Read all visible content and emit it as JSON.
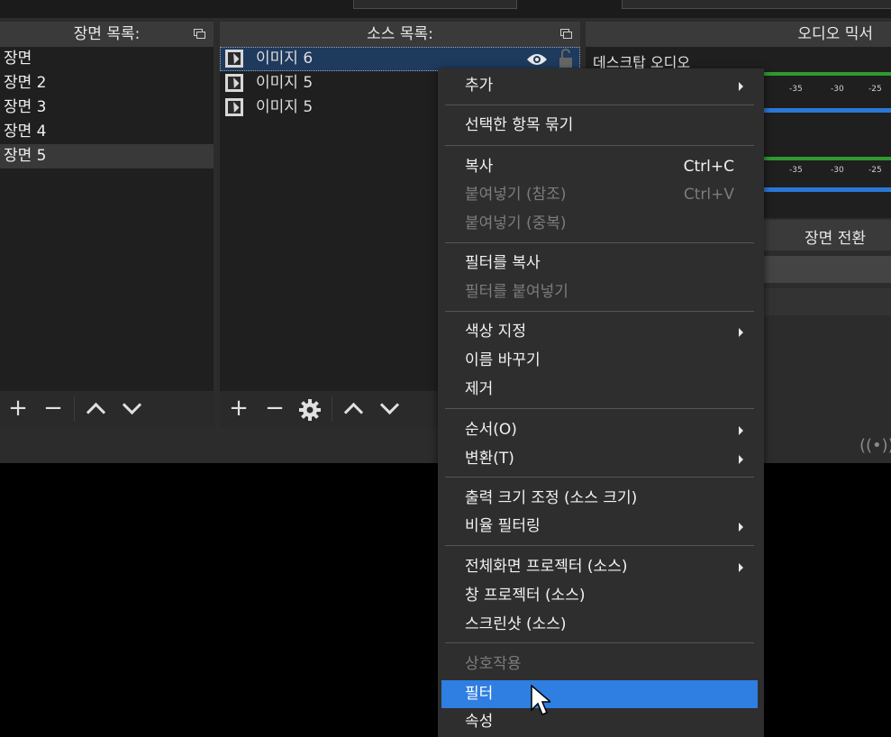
{
  "scenes_panel": {
    "title": "장면 목록:",
    "items": [
      "장면",
      "장면 2",
      "장면 3",
      "장면 4",
      "장면 5"
    ],
    "active_item": "장면 5"
  },
  "sources_panel": {
    "title": "소스 목록:",
    "items": [
      "이미지 6",
      "이미지 5",
      "이미지 5"
    ],
    "selected_item": "이미지 6"
  },
  "mixer": {
    "title": "오디오 믹서",
    "channel_label": "데스크탑 오디오",
    "ticks": [
      "-35",
      "-30",
      "-25"
    ]
  },
  "transitions": {
    "title": "장면 전환"
  },
  "context_menu": {
    "add": "추가",
    "group_selected": "선택한 항목 묶기",
    "copy": "복사",
    "copy_shortcut": "Ctrl+C",
    "paste_ref": "붙여넣기 (참조)",
    "paste_ref_shortcut": "Ctrl+V",
    "paste_dup": "붙여넣기 (중복)",
    "copy_filters": "필터를 복사",
    "paste_filters": "필터를 붙여넣기",
    "set_color": "색상 지정",
    "rename": "이름 바꾸기",
    "remove": "제거",
    "order": "순서(O)",
    "transform": "변환(T)",
    "resize_output": "출력 크기 조정 (소스 크기)",
    "scale_filtering": "비율 필터링",
    "fullscreen_projector": "전체화면 프로젝터 (소스)",
    "window_projector": "창 프로젝터 (소스)",
    "screenshot": "스크린샷 (소스)",
    "interact": "상호작용",
    "filters": "필터",
    "properties": "속성"
  },
  "colors": {
    "highlight": "#2f7ee1",
    "meter_green": "#2f9a2f",
    "meter_blue": "#2b77d6",
    "selected_source": "#1e3a5c"
  }
}
